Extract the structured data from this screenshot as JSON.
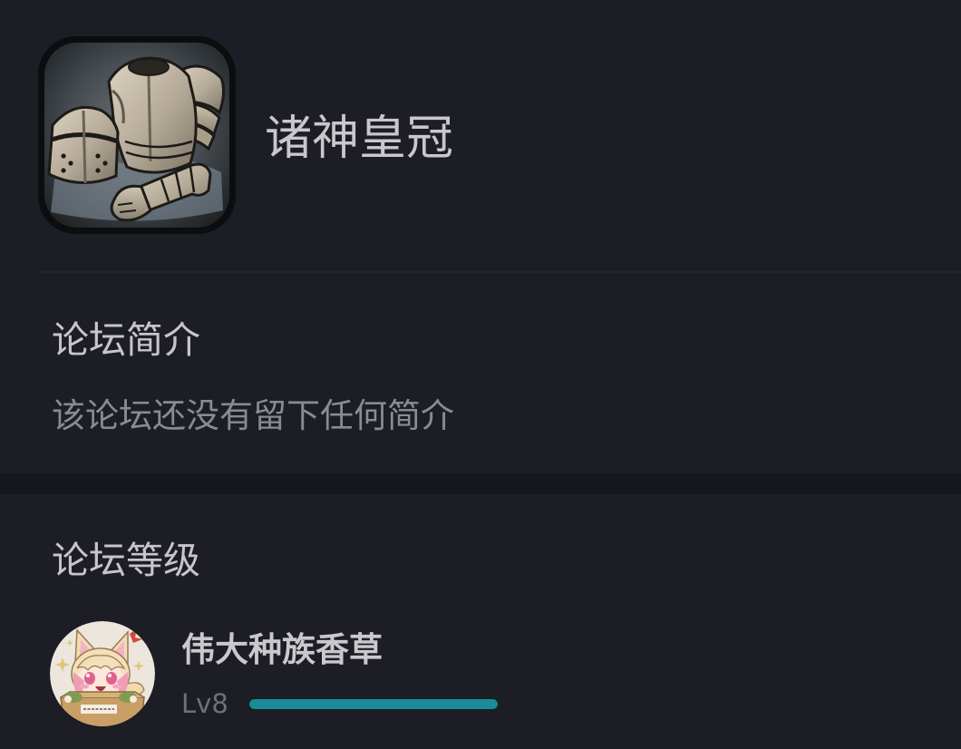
{
  "forum": {
    "logo": "knight-armor-image",
    "name": "诸神皇冠"
  },
  "intro": {
    "heading": "论坛简介",
    "text": "该论坛还没有留下任何简介"
  },
  "level": {
    "heading": "论坛等级",
    "user": {
      "avatar": "fox-girl-in-box-image",
      "name": "伟大种族香草",
      "level_label": "Lv8",
      "progress": 1.0,
      "progress_color": "#1a8c97"
    }
  },
  "colors": {
    "background": "#1c1d25",
    "band": "#16171c",
    "primary_text": "#c8c8cc",
    "secondary_text": "#8a8b91",
    "accent": "#1a8c97"
  }
}
